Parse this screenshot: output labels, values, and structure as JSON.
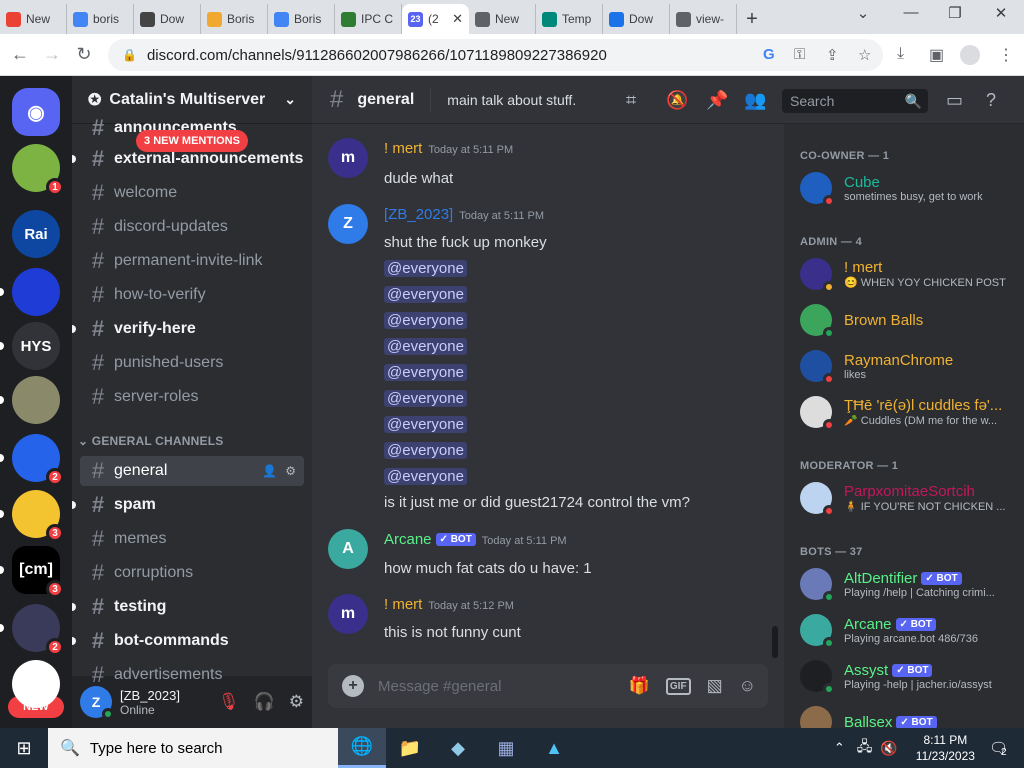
{
  "browser": {
    "tabs": [
      {
        "label": "New",
        "icon": "gmail-icon",
        "color": "#ea4335"
      },
      {
        "label": "boris",
        "icon": "google-icon",
        "color": "#4285f4"
      },
      {
        "label": "Dow",
        "icon": "document-icon",
        "color": "#444444"
      },
      {
        "label": "Boris",
        "icon": "boris-icon",
        "color": "#f0a830"
      },
      {
        "label": "Boris",
        "icon": "google-icon",
        "color": "#4285f4"
      },
      {
        "label": "IPC C",
        "icon": "ipc-icon",
        "color": "#2e7d32"
      },
      {
        "label": "(2",
        "icon": "discord-icon",
        "color": "#5865f2",
        "badge": "23"
      },
      {
        "label": "New",
        "icon": "chrome-icon",
        "color": "#5f6368"
      },
      {
        "label": "Temp",
        "icon": "temp-icon",
        "color": "#00897b"
      },
      {
        "label": "Dow",
        "icon": "download-icon",
        "color": "#1a73e8"
      },
      {
        "label": "view-",
        "icon": "chrome-icon",
        "color": "#5f6368"
      }
    ],
    "url": "discord.com/channels/911286602007986266/1071189809227386920"
  },
  "servers": [
    {
      "label": "Discord home",
      "icon": "discord-icon",
      "color": "#5865f2",
      "text": ""
    },
    {
      "label": "Turtle",
      "icon": "turtle-icon",
      "color": "#7cb342",
      "text": "",
      "badge": "1"
    },
    {
      "label": "Rai",
      "icon": "rai-icon",
      "color": "#0d47a1",
      "text": "Rai"
    },
    {
      "label": "Blue",
      "icon": "blue-icon",
      "color": "#1f3dd6",
      "text": ""
    },
    {
      "label": "HYS",
      "icon": "hys-icon",
      "color": "#313338",
      "text": "HYS"
    },
    {
      "label": "Fish",
      "icon": "fish-icon",
      "color": "#8a8a6b",
      "text": ""
    },
    {
      "label": "Catalin",
      "icon": "window-icon",
      "color": "#2563eb",
      "text": "",
      "badge": "2"
    },
    {
      "label": "Mascot",
      "icon": "mascot-icon",
      "color": "#f4c430",
      "text": "",
      "badge": "3"
    },
    {
      "label": "cm",
      "icon": "cm-icon",
      "color": "#000000",
      "text": "[cm]",
      "badge": "3"
    },
    {
      "label": "Dark",
      "icon": "dark-icon",
      "color": "#3a3a5a",
      "text": "",
      "badge": "2"
    },
    {
      "label": "Hex",
      "icon": "hex-icon",
      "color": "#ffffff",
      "text": ""
    }
  ],
  "new_badge": "NEW",
  "guild": {
    "name": "Catalin's Multiserver",
    "mentions_banner": "3 NEW MENTIONS",
    "channels": [
      {
        "name": "announcements",
        "unread": true
      },
      {
        "name": "external-announcements",
        "unread": true
      },
      {
        "name": "welcome",
        "unread": false
      },
      {
        "name": "discord-updates",
        "unread": false
      },
      {
        "name": "permanent-invite-link",
        "unread": false
      },
      {
        "name": "how-to-verify",
        "unread": false
      },
      {
        "name": "verify-here",
        "unread": true
      },
      {
        "name": "punished-users",
        "unread": false
      },
      {
        "name": "server-roles",
        "unread": false
      }
    ],
    "category": "GENERAL CHANNELS",
    "channels2": [
      {
        "name": "general",
        "unread": false,
        "active": true
      },
      {
        "name": "spam",
        "unread": true
      },
      {
        "name": "memes",
        "unread": false
      },
      {
        "name": "corruptions",
        "unread": false
      },
      {
        "name": "testing",
        "unread": true
      },
      {
        "name": "bot-commands",
        "unread": true
      },
      {
        "name": "advertisements",
        "unread": false
      }
    ]
  },
  "user": {
    "name": "[ZB_2023]",
    "status": "Online"
  },
  "chat": {
    "channel": "general",
    "topic": "main talk about stuff.",
    "search_placeholder": "Search",
    "composer_placeholder": "Message #general",
    "messages": [
      {
        "author": "! mert",
        "color": "#f0b232",
        "time": "Today at 5:11 PM",
        "avatar_color": "#3a2f8a",
        "lines": [
          "dude what"
        ]
      },
      {
        "author": "[ZB_2023]",
        "color": "#2f7be8",
        "time": "Today at 5:11 PM",
        "avatar_color": "#2f7be8",
        "lines": [
          "shut the fuck up monkey",
          "@everyone",
          "@everyone",
          "@everyone",
          "@everyone",
          "@everyone",
          "@everyone",
          "@everyone",
          "@everyone",
          "@everyone",
          "is it just me or did guest21724 control the vm?"
        ]
      },
      {
        "author": "Arcane",
        "color": "#57f287",
        "time": "Today at 5:11 PM",
        "avatar_color": "#3aa99f",
        "bot": "✓ BOT",
        "lines": [
          "how much fat cats do u have: 1"
        ]
      },
      {
        "author": "! mert",
        "color": "#f0b232",
        "time": "Today at 5:12 PM",
        "avatar_color": "#3a2f8a",
        "lines": [
          "this is not funny cunt"
        ]
      }
    ]
  },
  "members": {
    "groups": [
      {
        "title": "CO-OWNER — 1",
        "members": [
          {
            "name": "Cube",
            "color": "#1abc9c",
            "sub": "sometimes busy, get to work",
            "status": "dnd",
            "avatar": "#1f5fbf"
          }
        ]
      },
      {
        "title": "ADMIN — 4",
        "members": [
          {
            "name": "! mert",
            "color": "#f0b232",
            "sub": "😊 WHEN YOY CHICKEN POST",
            "status": "idle",
            "avatar": "#3a2f8a"
          },
          {
            "name": "Brown Balls",
            "color": "#f0b232",
            "sub": "",
            "status": "online",
            "avatar": "#3ba55c"
          },
          {
            "name": "RaymanChrome",
            "color": "#f0b232",
            "sub": "likes",
            "status": "dnd",
            "avatar": "#1f4fa0"
          },
          {
            "name": "ŢĦē 'rē(ə)l cuddles fə'...",
            "color": "#f0b232",
            "sub": "🥕 Cuddles (DM me for the w...",
            "status": "dnd",
            "avatar": "#dddddd"
          }
        ]
      },
      {
        "title": "MODERATOR — 1",
        "members": [
          {
            "name": "ParpxomitaeSortcih",
            "color": "#c2185b",
            "sub": "🧍 IF YOU'RE NOT CHICKEN ...",
            "status": "dnd",
            "avatar": "#bcd4f0"
          }
        ]
      },
      {
        "title": "BOTS — 37",
        "members": [
          {
            "name": "AltDentifier",
            "color": "#57f287",
            "sub": "Playing /help | Catching crimi...",
            "status": "online",
            "avatar": "#6a7ab8",
            "bot": "✓ BOT"
          },
          {
            "name": "Arcane",
            "color": "#57f287",
            "sub": "Playing arcane.bot 486/736",
            "status": "online",
            "avatar": "#3aa99f",
            "bot": "✓ BOT"
          },
          {
            "name": "Assyst",
            "color": "#57f287",
            "sub": "Playing -help | jacher.io/assyst",
            "status": "online",
            "avatar": "#1e1f22",
            "bot": "✓ BOT"
          },
          {
            "name": "Ballsex",
            "color": "#57f287",
            "sub": "",
            "status": "online",
            "avatar": "#8b6b4a",
            "bot": "✓ BOT"
          }
        ]
      }
    ]
  },
  "taskbar": {
    "search_placeholder": "Type here to search",
    "time": "8:11 PM",
    "date": "11/23/2023",
    "notifications": "2"
  }
}
